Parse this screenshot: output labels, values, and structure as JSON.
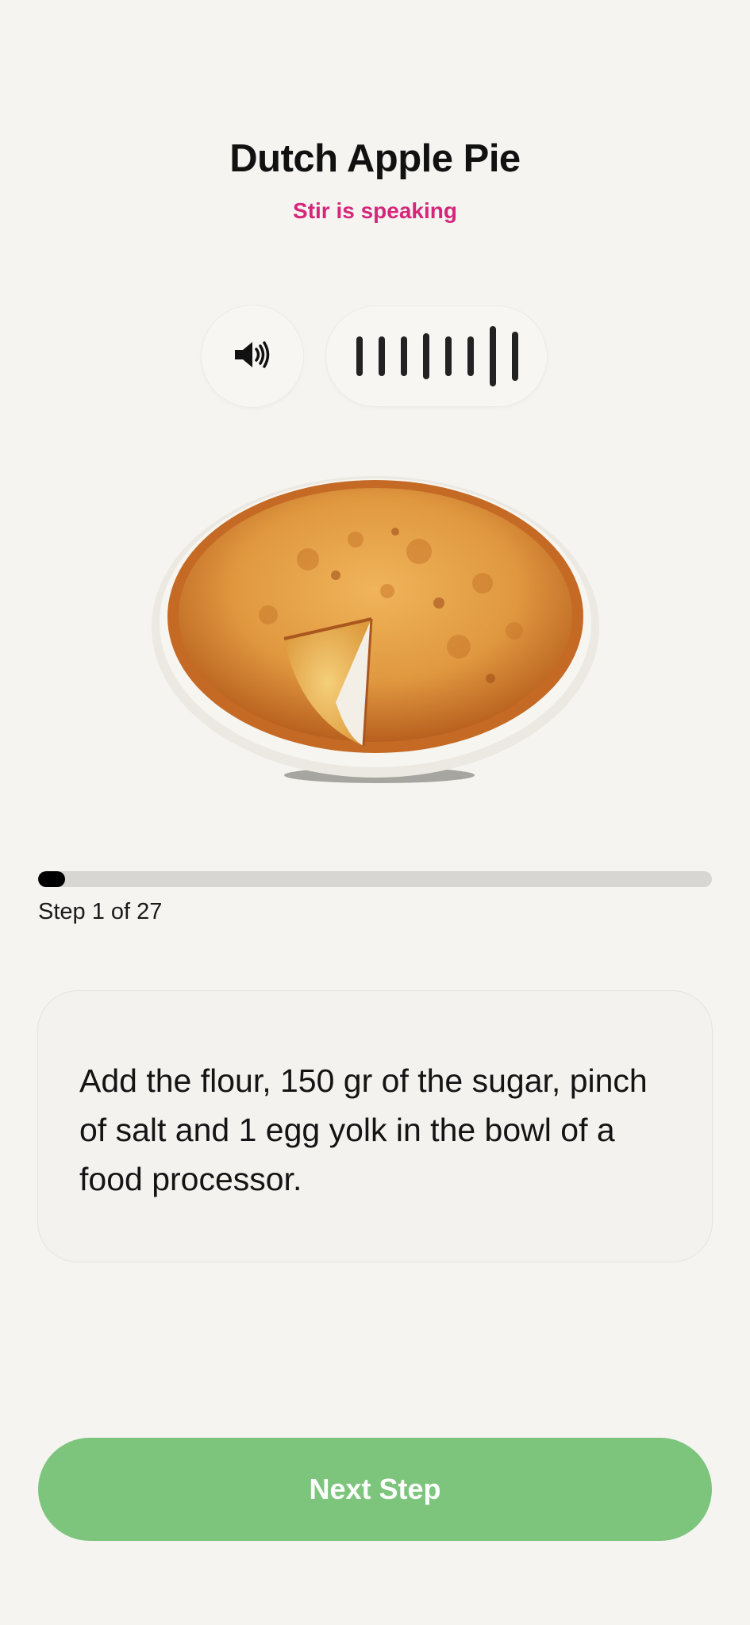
{
  "recipe": {
    "title": "Dutch Apple Pie",
    "status": "Stir is speaking"
  },
  "audio": {
    "speaker_icon": "speaker-volume-icon",
    "waveform_bars": 8
  },
  "hero_image": {
    "subject": "dutch-apple-pie-photo"
  },
  "progress": {
    "current_step": 1,
    "total_steps": 27,
    "label": "Step 1 of 27"
  },
  "instruction": {
    "text": "Add the flour, 150 gr of the sugar, pinch of salt and 1 egg yolk in the bowl of a food processor."
  },
  "actions": {
    "next_label": "Next Step"
  },
  "colors": {
    "background": "#f5f4f1",
    "accent_pink": "#d6267a",
    "next_button": "#7dc57d",
    "progress_fill": "#000000",
    "progress_track": "#d7d6d2"
  }
}
